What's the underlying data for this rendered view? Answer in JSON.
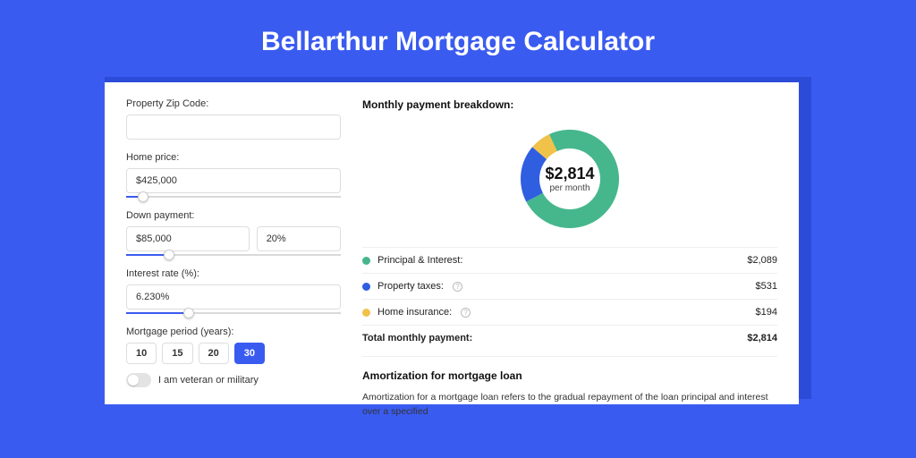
{
  "page": {
    "title": "Bellarthur Mortgage Calculator"
  },
  "form": {
    "zip": {
      "label": "Property Zip Code:",
      "value": ""
    },
    "home_price": {
      "label": "Home price:",
      "value": "$425,000",
      "slider_pct": 8
    },
    "down_payment": {
      "label": "Down payment:",
      "value_amount": "$85,000",
      "value_pct": "20%",
      "slider_pct": 20
    },
    "interest_rate": {
      "label": "Interest rate (%):",
      "value": "6.230%",
      "slider_pct": 29
    },
    "mortgage_period": {
      "label": "Mortgage period (years):",
      "options": [
        "10",
        "15",
        "20",
        "30"
      ],
      "active_index": 3
    },
    "veteran_toggle": {
      "label": "I am veteran or military",
      "checked": false
    }
  },
  "breakdown": {
    "header": "Monthly payment breakdown:",
    "center_amount": "$2,814",
    "center_sub": "per month",
    "items": [
      {
        "label": "Principal & Interest:",
        "value": "$2,089",
        "color": "#46b78d",
        "numeric": 2089,
        "has_help": false
      },
      {
        "label": "Property taxes:",
        "value": "$531",
        "color": "#2f5ee0",
        "numeric": 531,
        "has_help": true
      },
      {
        "label": "Home insurance:",
        "value": "$194",
        "color": "#f1c24a",
        "numeric": 194,
        "has_help": true
      }
    ],
    "total": {
      "label": "Total monthly payment:",
      "value": "$2,814"
    }
  },
  "amortization": {
    "header": "Amortization for mortgage loan",
    "body": "Amortization for a mortgage loan refers to the gradual repayment of the loan principal and interest over a specified"
  },
  "chart_data": {
    "type": "pie",
    "title": "Monthly payment breakdown",
    "series": [
      {
        "name": "Principal & Interest",
        "value": 2089,
        "color": "#46b78d"
      },
      {
        "name": "Property taxes",
        "value": 531,
        "color": "#2f5ee0"
      },
      {
        "name": "Home insurance",
        "value": 194,
        "color": "#f1c24a"
      }
    ],
    "total": 2814,
    "center_label": "$2,814 per month"
  }
}
